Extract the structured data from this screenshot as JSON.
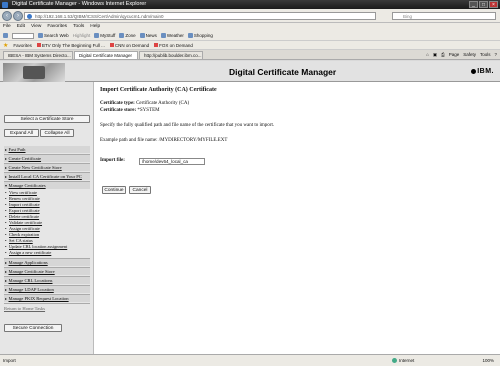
{
  "window": {
    "title": "Digital Certificate Manager - Windows Internet Explorer",
    "controls": [
      "_",
      "□",
      "×"
    ]
  },
  "address": {
    "url": "http://192.168.1.53/QIBM/ICSS/Cert/Admin/qycucm1.ndm/main0",
    "search_placeholder": "Bing"
  },
  "menu": [
    "File",
    "Edit",
    "View",
    "Favorites",
    "Tools",
    "Help"
  ],
  "toolbar": {
    "items": [
      "Search Web",
      "Highlight",
      "MyStuff",
      "Zone",
      "News",
      "Weather",
      "Shopping"
    ]
  },
  "favorites": {
    "label": "Favorites",
    "items": [
      "BTV Only The Beginning Full ...",
      "CNN on Demand",
      "FOX on Demand"
    ]
  },
  "tabs": {
    "items": [
      {
        "label": "IBESA - IBM Systems Directo...",
        "active": false
      },
      {
        "label": "Digital Certificate Manager",
        "active": true
      },
      {
        "label": "http://publib.boulder.ibm.co...",
        "active": false
      }
    ],
    "tools": [
      "Page",
      "Safety",
      "Tools"
    ]
  },
  "page": {
    "header_title": "Digital Certificate Manager",
    "brand": "IBM"
  },
  "nav": {
    "select_store": "Select a Certificate Store",
    "expand_all": "Expand All",
    "collapse_all": "Collapse All",
    "fast_path": "Fast Path",
    "create_certificate": "Create Certificate",
    "create_store": "Create New Certificate Store",
    "install_ca": "Install Local CA Certificate on Your PC",
    "manage_certificates": "Manage Certificates",
    "subitems": [
      "View certificate",
      "Renew certificate",
      "Import certificate",
      "Export certificate",
      "Delete certificate",
      "Validate certificate",
      "Assign certificate",
      "Check expiration",
      "Set CA status",
      "Update CRL location assignment",
      "Assign a new certificate"
    ],
    "manage_applications": "Manage Applications",
    "manage_store": "Manage Certificate Store",
    "manage_crl": "Manage CRL Locations",
    "manage_ldap": "Manage LDAP Location",
    "manage_pkix": "Manage PKIX Request Location",
    "return_home": "Return to Home Tasks",
    "secure_connection": "Secure Connection"
  },
  "main": {
    "heading": "Import Certificate Authority (CA) Certificate",
    "cert_type_label": "Certificate type:",
    "cert_type_value": "Certificate Authority (CA)",
    "cert_store_label": "Certificate store:",
    "cert_store_value": "*SYSTEM",
    "instructions": "Specify the fully qualified path and file name of the certificate that you want to import.",
    "example_label": "Example path and file name:",
    "example_value": "/MYDIRECTORY/MYFILE.EXT",
    "import_file_label": "Import file:",
    "import_file_value": "/home/dev64_local_ca",
    "continue_label": "Continue",
    "cancel_label": "Cancel"
  },
  "status": {
    "left": "Import",
    "zone": "Internet",
    "zoom": "100%"
  }
}
